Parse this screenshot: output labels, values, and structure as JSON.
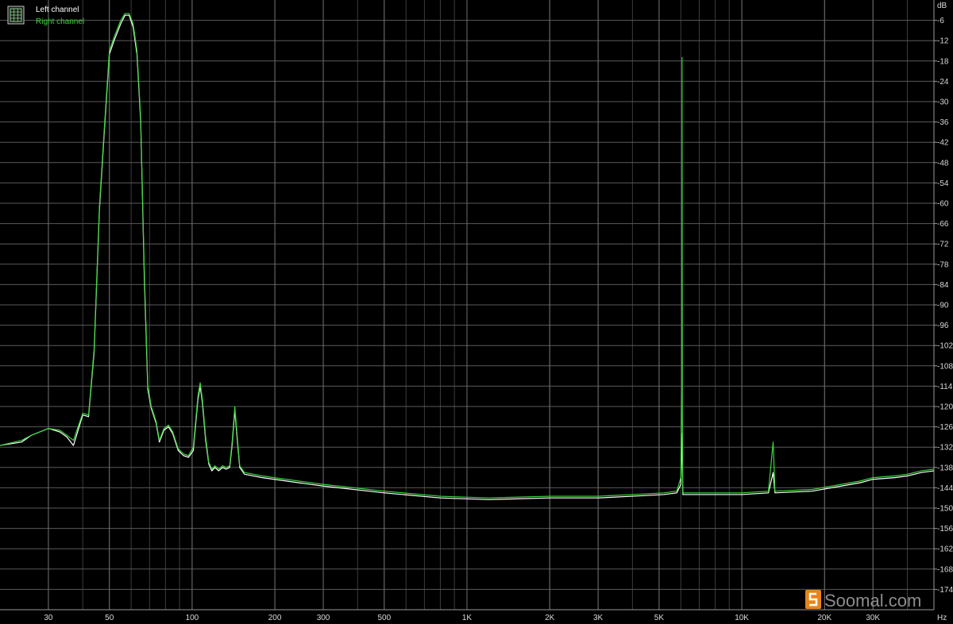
{
  "chart_data": {
    "type": "line",
    "title": "",
    "xlabel": "",
    "ylabel": "",
    "x_unit": "Hz",
    "y_unit": "dB",
    "x_scale": "log",
    "xlim": [
      20,
      50000
    ],
    "ylim": [
      -180,
      0
    ],
    "grid": true,
    "legend_position": "top-left",
    "x_ticks": [
      {
        "value": 30,
        "label": "30"
      },
      {
        "value": 50,
        "label": "50"
      },
      {
        "value": 100,
        "label": "100"
      },
      {
        "value": 200,
        "label": "200"
      },
      {
        "value": 300,
        "label": "300"
      },
      {
        "value": 500,
        "label": "500"
      },
      {
        "value": 1000,
        "label": "1K"
      },
      {
        "value": 2000,
        "label": "2K"
      },
      {
        "value": 3000,
        "label": "3K"
      },
      {
        "value": 5000,
        "label": "5K"
      },
      {
        "value": 10000,
        "label": "10K"
      },
      {
        "value": 20000,
        "label": "20K"
      },
      {
        "value": 30000,
        "label": "30K"
      }
    ],
    "y_ticks": [
      -6,
      -12,
      -18,
      -24,
      -30,
      -36,
      -42,
      -48,
      -54,
      -60,
      -66,
      -72,
      -78,
      -84,
      -90,
      -96,
      -102,
      -108,
      -114,
      -120,
      -126,
      -132,
      -138,
      -144,
      -150,
      -156,
      -162,
      -168,
      -174
    ],
    "series": [
      {
        "name": "Left channel",
        "color": "#ffffff",
        "points": [
          [
            20,
            -131.5
          ],
          [
            24,
            -130.5
          ],
          [
            26,
            -128.5
          ],
          [
            30,
            -126.5
          ],
          [
            33,
            -127.5
          ],
          [
            35,
            -129
          ],
          [
            37,
            -131.5
          ],
          [
            40,
            -122.5
          ],
          [
            42,
            -123
          ],
          [
            44,
            -104
          ],
          [
            46,
            -62
          ],
          [
            48,
            -38
          ],
          [
            50,
            -16
          ],
          [
            52,
            -12
          ],
          [
            55,
            -7
          ],
          [
            57,
            -4.5
          ],
          [
            59,
            -4.5
          ],
          [
            61,
            -8
          ],
          [
            63,
            -16
          ],
          [
            65,
            -36
          ],
          [
            67,
            -82
          ],
          [
            69,
            -115
          ],
          [
            71,
            -120.5
          ],
          [
            74,
            -125
          ],
          [
            76,
            -130.5
          ],
          [
            79,
            -127
          ],
          [
            82,
            -126
          ],
          [
            85,
            -128
          ],
          [
            89,
            -133
          ],
          [
            93,
            -134.5
          ],
          [
            97,
            -135
          ],
          [
            101,
            -133
          ],
          [
            105,
            -118
          ],
          [
            107,
            -114
          ],
          [
            109,
            -119
          ],
          [
            112,
            -130
          ],
          [
            115,
            -137
          ],
          [
            118,
            -139
          ],
          [
            121,
            -138
          ],
          [
            125,
            -139
          ],
          [
            129,
            -138
          ],
          [
            133,
            -138.5
          ],
          [
            137,
            -138
          ],
          [
            140,
            -131
          ],
          [
            143,
            -121
          ],
          [
            146,
            -130
          ],
          [
            149,
            -138
          ],
          [
            155,
            -140
          ],
          [
            180,
            -141
          ],
          [
            220,
            -142
          ],
          [
            300,
            -143.5
          ],
          [
            500,
            -145.5
          ],
          [
            800,
            -147
          ],
          [
            1200,
            -147.5
          ],
          [
            2000,
            -147
          ],
          [
            3000,
            -147
          ],
          [
            4000,
            -146.5
          ],
          [
            5200,
            -146
          ],
          [
            5800,
            -145.5
          ],
          [
            6000,
            -143
          ],
          [
            6060,
            -128
          ],
          [
            6100,
            -146
          ],
          [
            6200,
            -146
          ],
          [
            7000,
            -146
          ],
          [
            10000,
            -146
          ],
          [
            12500,
            -145.5
          ],
          [
            13000,
            -139.5
          ],
          [
            13200,
            -145.5
          ],
          [
            18000,
            -145
          ],
          [
            23000,
            -143.5
          ],
          [
            27000,
            -142.5
          ],
          [
            30000,
            -141.5
          ],
          [
            36000,
            -141
          ],
          [
            40000,
            -140.5
          ],
          [
            45000,
            -139.5
          ],
          [
            50000,
            -139
          ]
        ]
      },
      {
        "name": "Right channel",
        "color": "#39d639",
        "points": [
          [
            20,
            -131.5
          ],
          [
            24,
            -130
          ],
          [
            26,
            -128.5
          ],
          [
            30,
            -126.5
          ],
          [
            33,
            -127
          ],
          [
            35,
            -128.5
          ],
          [
            37,
            -130
          ],
          [
            40,
            -122
          ],
          [
            42,
            -122.5
          ],
          [
            44,
            -103
          ],
          [
            46,
            -61
          ],
          [
            48,
            -37
          ],
          [
            50,
            -15
          ],
          [
            52,
            -11
          ],
          [
            55,
            -6
          ],
          [
            57,
            -4
          ],
          [
            59,
            -4
          ],
          [
            61,
            -7
          ],
          [
            63,
            -15
          ],
          [
            65,
            -35
          ],
          [
            67,
            -80
          ],
          [
            69,
            -114
          ],
          [
            71,
            -120
          ],
          [
            74,
            -124.5
          ],
          [
            76,
            -130
          ],
          [
            79,
            -126.5
          ],
          [
            82,
            -125.5
          ],
          [
            85,
            -127.5
          ],
          [
            89,
            -132.5
          ],
          [
            93,
            -134
          ],
          [
            97,
            -134.5
          ],
          [
            101,
            -132
          ],
          [
            105,
            -117
          ],
          [
            107,
            -113
          ],
          [
            109,
            -118
          ],
          [
            112,
            -129
          ],
          [
            115,
            -136.5
          ],
          [
            118,
            -138.5
          ],
          [
            121,
            -137.5
          ],
          [
            125,
            -138.5
          ],
          [
            129,
            -137.5
          ],
          [
            133,
            -138
          ],
          [
            137,
            -137.5
          ],
          [
            140,
            -130
          ],
          [
            143,
            -120
          ],
          [
            146,
            -129
          ],
          [
            149,
            -137.5
          ],
          [
            155,
            -139.5
          ],
          [
            180,
            -140.5
          ],
          [
            220,
            -141.5
          ],
          [
            300,
            -143
          ],
          [
            500,
            -145
          ],
          [
            800,
            -146.5
          ],
          [
            1200,
            -147
          ],
          [
            2000,
            -146.5
          ],
          [
            3000,
            -146.5
          ],
          [
            4000,
            -146
          ],
          [
            5200,
            -145.5
          ],
          [
            5800,
            -145
          ],
          [
            6000,
            -141
          ],
          [
            6050,
            -114
          ],
          [
            6060,
            -17
          ],
          [
            6075,
            -121
          ],
          [
            6100,
            -145.5
          ],
          [
            6200,
            -145.5
          ],
          [
            7000,
            -145.5
          ],
          [
            10000,
            -145.5
          ],
          [
            12500,
            -145
          ],
          [
            13000,
            -130.5
          ],
          [
            13200,
            -145
          ],
          [
            18000,
            -144.5
          ],
          [
            23000,
            -143
          ],
          [
            27000,
            -142
          ],
          [
            30000,
            -141
          ],
          [
            36000,
            -140.5
          ],
          [
            40000,
            -140
          ],
          [
            45000,
            -139
          ],
          [
            50000,
            -138.5
          ]
        ]
      }
    ]
  },
  "legend_icon": "grid-icon",
  "watermark": {
    "text": "Soomal.com",
    "icon": "soomal-logo-icon"
  }
}
